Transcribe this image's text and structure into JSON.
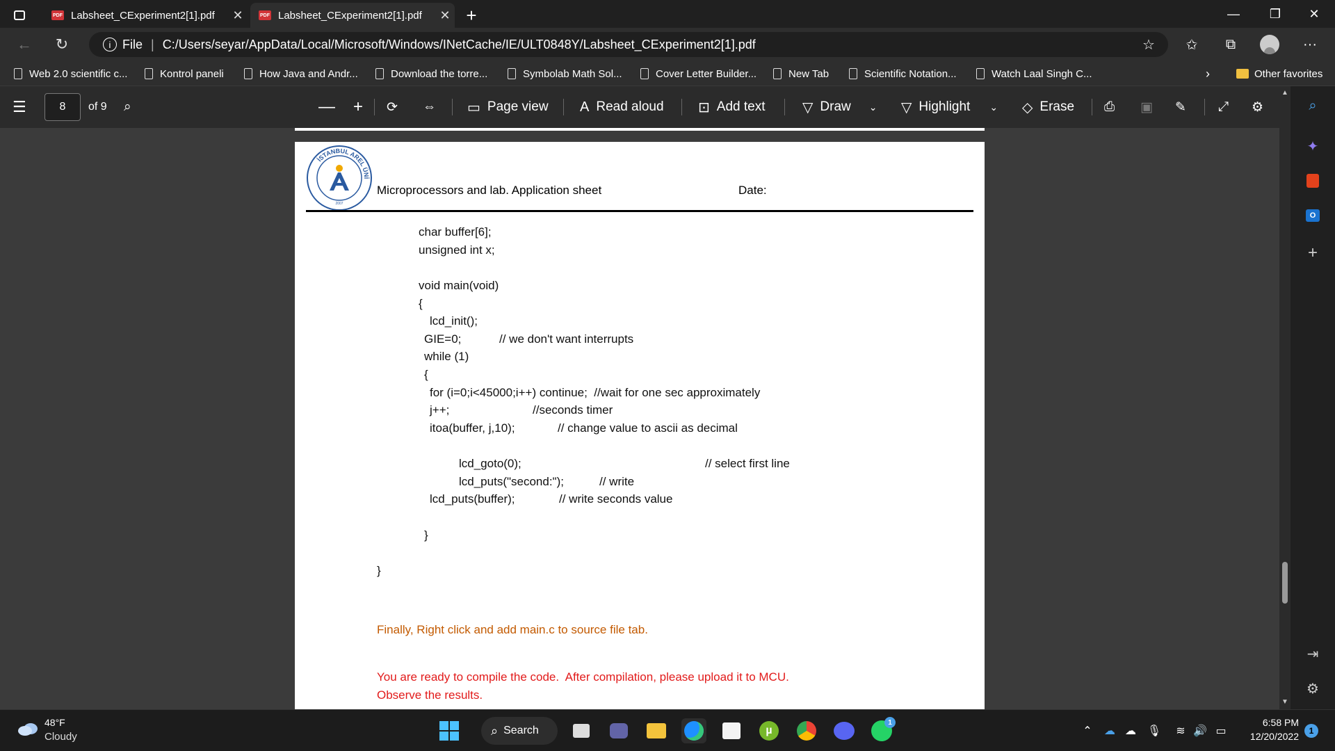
{
  "tabs": [
    {
      "title": "Labsheet_CExperiment2[1].pdf",
      "badge": "PDF"
    },
    {
      "title": "Labsheet_CExperiment2[1].pdf",
      "badge": "PDF"
    }
  ],
  "address": {
    "scheme": "File",
    "url": "C:/Users/seyar/AppData/Local/Microsoft/Windows/INetCache/IE/ULT0848Y/Labsheet_CExperiment2[1].pdf"
  },
  "favorites": [
    "Web 2.0 scientific c...",
    "Kontrol paneli",
    "How Java and Andr...",
    "Download the torre...",
    "Symbolab Math Sol...",
    "Cover Letter Builder...",
    "New Tab",
    "Scientific Notation...",
    "Watch Laal Singh C..."
  ],
  "other_favorites": "Other favorites",
  "pdf_toolbar": {
    "page_current": "8",
    "page_total": "of 9",
    "page_view": "Page view",
    "read_aloud": "Read aloud",
    "add_text": "Add text",
    "draw": "Draw",
    "highlight": "Highlight",
    "erase": "Erase"
  },
  "document": {
    "header_title": "Microprocessors and lab.  Application sheet",
    "header_date": "Date:",
    "logo_text_top": "ARE",
    "logo_text_left": "İSTANBUL",
    "logo_text_right": "ÜNİVERSİTESİ",
    "logo_year": "2007",
    "code_lines": [
      "char buffer[6];",
      "unsigned int x;",
      "void main(void)",
      "{",
      "lcd_init();",
      "GIE=0;",
      "// we don't want interrupts",
      "while (1)",
      "{",
      "for (i=0;i<45000;i++) continue;  //wait for one sec approximately",
      "j++;",
      "//seconds timer",
      "itoa(buffer, j,10);",
      "// change value to ascii as decimal",
      "lcd_goto(0);",
      "// select first line",
      "lcd_puts(\"second:\");",
      "// write",
      "lcd_puts(buffer);",
      "// write seconds value",
      "}",
      "}"
    ],
    "instruction_1": "Finally, Right click and add main.c to source file tab.",
    "instruction_2": "You are ready to compile the code.  After compilation, please upload it to MCU.",
    "instruction_3": "Observe the results."
  },
  "taskbar": {
    "temperature": "48°F",
    "condition": "Cloudy",
    "search": "Search",
    "time": "6:58 PM",
    "date": "12/20/2022",
    "notifications": "1",
    "whatsapp_badge": "1"
  },
  "colors": {
    "orange_text": "#c35a00",
    "red_text": "#e21b1b",
    "pdf_badge": "#d13438",
    "edge_accent": "#1e90ff"
  }
}
